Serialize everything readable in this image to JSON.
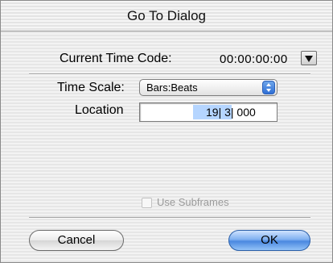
{
  "dialog": {
    "title": "Go To Dialog",
    "current_time_code": {
      "label": "Current Time Code:",
      "value": "00:00:00:00",
      "menu_icon": "triangle-down-icon"
    },
    "time_scale": {
      "label": "Time Scale:",
      "selected": "Bars:Beats"
    },
    "location": {
      "label": "Location",
      "value": "19| 3| 000"
    },
    "use_subframes": {
      "label": "Use Subframes",
      "checked": false,
      "enabled": false
    },
    "buttons": {
      "cancel": "Cancel",
      "ok": "OK"
    }
  },
  "colors": {
    "default_button": "#4a88e0",
    "selection": "#b5d5ff"
  }
}
